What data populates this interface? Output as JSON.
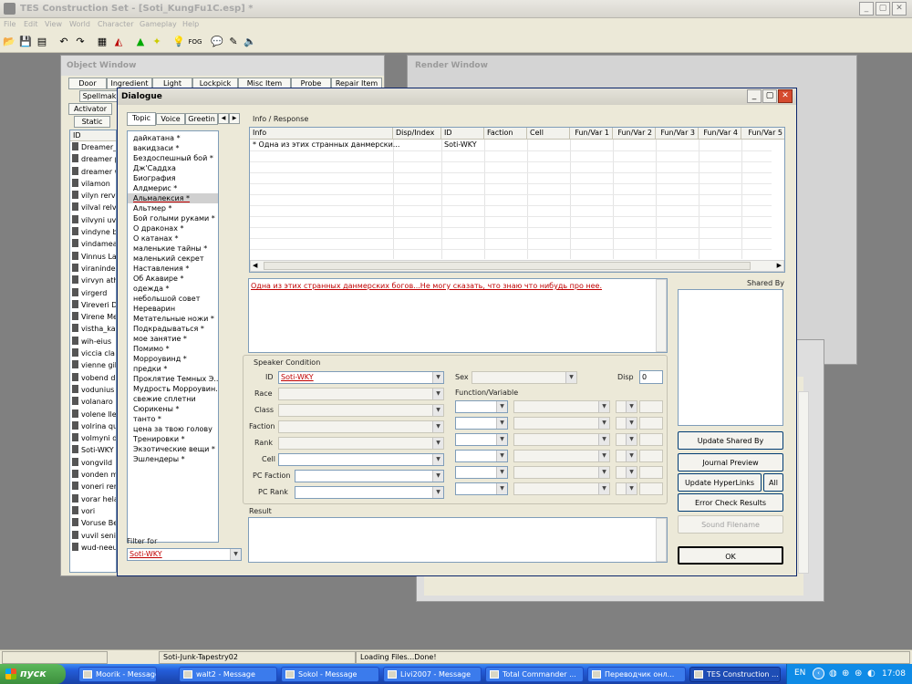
{
  "app": {
    "title": "TES Construction Set - [Soti_KungFu1C.esp] *"
  },
  "menu": [
    "File",
    "Edit",
    "View",
    "World",
    "Character",
    "Gameplay",
    "Help"
  ],
  "object_window": {
    "title": "Object Window",
    "tabs_row1": [
      "Door",
      "Ingredient",
      "Light",
      "Lockpick",
      "Misc Item",
      "Probe",
      "Repair Item"
    ],
    "tabs_row2": [
      "Spellmak"
    ],
    "tabs_row3": [
      "Activator"
    ],
    "tabs_row4": [
      "Static"
    ],
    "column": "ID",
    "items": [
      "Dreamer_",
      "dreamer p",
      "dreamer w",
      "vilamon",
      "vilyn rerva",
      "vilval relv",
      "vilvyni uv",
      "vindyne b",
      "vindamea",
      "Vinnus La",
      "viraninde",
      "virvyn ath",
      "virgerd",
      "Vireveri D",
      "Virene Me",
      "vistha_ka",
      "wih-eius",
      "viccia cla",
      "vienne gil",
      "vobend d",
      "vodunius",
      "volanaro",
      "volene lle",
      "volrina qu",
      "volmyni dr",
      "Soti-WKY",
      "vongvild",
      "vonden m",
      "voneri rer",
      "vorar hela",
      "vori",
      "Voruse Be",
      "vuvil senil",
      "wud-neeu"
    ]
  },
  "render_window": {
    "title": "Render Window"
  },
  "dialogue": {
    "title": "Dialogue",
    "tabs": [
      "Topic",
      "Voice",
      "Greetin"
    ],
    "topics": [
      "дайкатана *",
      "вакидзаси *",
      "Бездоспешный бой *",
      "Дж'Саддха",
      "Биография",
      "Алдмерис *",
      "Альмалексия *",
      "Альтмер *",
      "Бой голыми руками *",
      "О драконах *",
      "О катанах *",
      "маленькие тайны *",
      "маленький секрет",
      "Наставления *",
      "Об Акавире *",
      "одежда *",
      "небольшой совет",
      "Нереварин",
      "Метательные ножи *",
      "Подкрадываться *",
      "мое занятие *",
      "Помимо *",
      "Морроувинд *",
      "предки *",
      "Проклятие Темных Э...",
      "Мудрость Морроувин...",
      "свежие сплетни",
      "Сюрикены *",
      "танто *",
      "цена за твою голову",
      "Тренировки *",
      "Экзотические вещи *",
      "Эшлендеры *"
    ],
    "selected_topic": "Альмалексия *",
    "filter_label": "Filter for",
    "filter_value": "Soti-WKY",
    "info_label": "Info / Response",
    "grid_headers": [
      "Info",
      "Disp/Index",
      "ID",
      "Faction",
      "Cell",
      "Fun/Var 1",
      "Fun/Var 2",
      "Fun/Var 3",
      "Fun/Var 4",
      "Fun/Var 5"
    ],
    "grid_rows": [
      {
        "info": "* Одна из этих странных данмерски...",
        "disp": "",
        "id": "Soti-WKY"
      }
    ],
    "response_text": "Одна из этих странных данмерских богов...Не могу сказать, что знаю что нибудь про нее.",
    "shared_by_label": "Shared By",
    "speaker_condition_label": "Speaker Condition",
    "labels": {
      "id": "ID",
      "race": "Race",
      "class": "Class",
      "faction": "Faction",
      "rank": "Rank",
      "cell": "Cell",
      "pc_faction": "PC Faction",
      "pc_rank": "PC Rank",
      "sex": "Sex",
      "disp": "Disp",
      "func_var": "Function/Variable",
      "result": "Result"
    },
    "id_value": "Soti-WKY",
    "disp_value": "0",
    "buttons": {
      "update_shared": "Update Shared By",
      "journal_preview": "Journal Preview",
      "update_hyperlinks": "Update HyperLinks",
      "all": "All",
      "error_check": "Error Check Results",
      "sound_filename": "Sound Filename",
      "ok": "OK"
    }
  },
  "status": {
    "cell2": "Soti-Junk-Tapestry02",
    "cell3": "Loading Files...Done!"
  },
  "taskbar": {
    "start": "пуск",
    "tasks": [
      "Moorik - Message",
      "walt2 - Message",
      "Sokol - Message",
      "Livi2007 - Message",
      "Total Commander ...",
      "Переводчик онл...",
      "TES Construction ..."
    ],
    "lang": "EN",
    "clock": "17:08"
  }
}
